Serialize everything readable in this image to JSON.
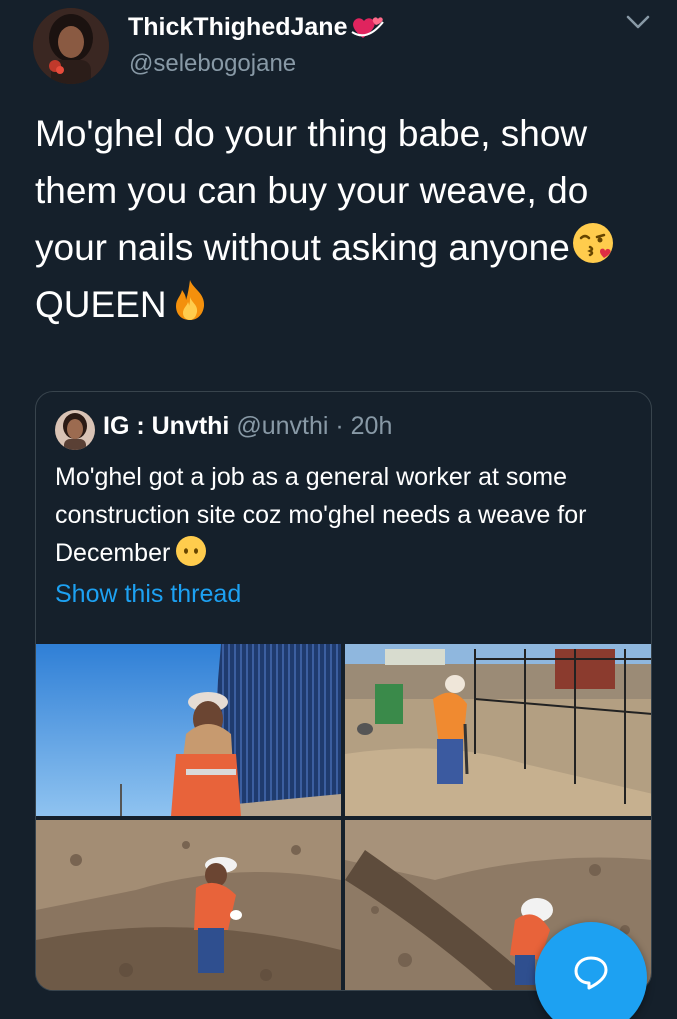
{
  "tweet": {
    "author": {
      "display_name": "ThickThighedJane",
      "handle": "@selebogojane",
      "name_emoji": "revolving-hearts-icon"
    },
    "text_parts": {
      "main": "Mo'ghel do your thing babe, show them you can buy your weave, do your nails without asking anyone",
      "after_emoji": " QUEEN"
    },
    "emojis": [
      "face-blowing-kiss-icon",
      "fire-icon"
    ]
  },
  "quoted_tweet": {
    "author_name": "IG : Unvthi",
    "handle": "@unvthi",
    "separator": " · ",
    "time": "20h",
    "text": "Mo'ghel got a job as a general worker at some construction site coz mo'ghel needs a weave for December",
    "emoji": "neutral-face-icon",
    "show_thread_label": "Show this thread",
    "photos": [
      "photo-woman-by-fence",
      "photo-digging-by-fence",
      "photo-trench-digging",
      "photo-trench-worker"
    ]
  },
  "fab": {
    "icon": "compose-reply-icon",
    "color": "#1da1f2"
  },
  "theme": {
    "background": "#15202b",
    "secondary_text": "#8899a6",
    "link": "#1da1f2",
    "border": "#38444d"
  }
}
